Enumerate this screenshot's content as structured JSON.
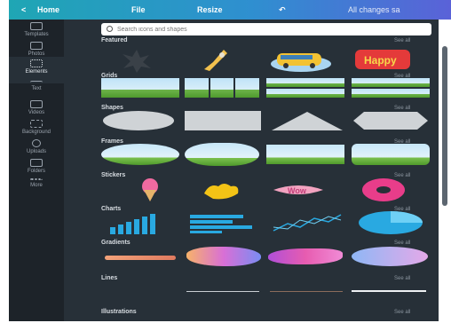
{
  "topbar": {
    "back": "<",
    "home": "Home",
    "file": "File",
    "resize": "Resize",
    "undo": "↶",
    "saved": "All changes sa"
  },
  "rail": [
    {
      "label": "Templates",
      "icon": "templates-icon"
    },
    {
      "label": "Photos",
      "icon": "photos-icon"
    },
    {
      "label": "Elements",
      "icon": "elements-icon",
      "active": true
    },
    {
      "label": "Text",
      "icon": "text-icon"
    },
    {
      "label": "Videos",
      "icon": "videos-icon"
    },
    {
      "label": "Background",
      "icon": "background-icon"
    },
    {
      "label": "Uploads",
      "icon": "uploads-icon"
    },
    {
      "label": "Folders",
      "icon": "folders-icon"
    },
    {
      "label": "More",
      "icon": "more-icon"
    }
  ],
  "search": {
    "placeholder": "Search icons and shapes"
  },
  "see_all": "See all",
  "sections": [
    {
      "title": "Featured"
    },
    {
      "title": "Grids"
    },
    {
      "title": "Shapes"
    },
    {
      "title": "Frames"
    },
    {
      "title": "Stickers"
    },
    {
      "title": "Charts"
    },
    {
      "title": "Gradients"
    },
    {
      "title": "Lines"
    },
    {
      "title": "Illustrations"
    }
  ],
  "sticker_text": "Wow",
  "featured_badge": "Happy",
  "colors": {
    "topbar_start": "#1fa6b4",
    "topbar_end": "#5a62d8",
    "rail_bg": "#1d2329",
    "panel_bg": "#273038"
  }
}
